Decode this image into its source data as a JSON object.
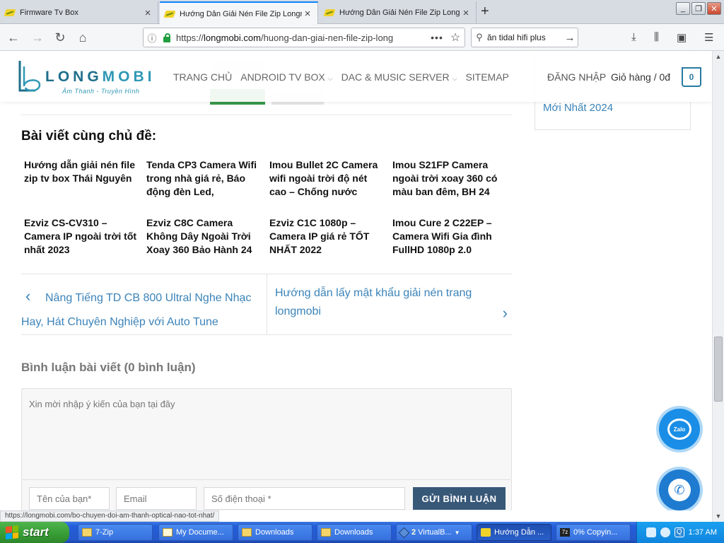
{
  "browser": {
    "tabs": [
      {
        "title": "Firmware Tv Box",
        "active": false
      },
      {
        "title": "Hướng Dẫn Giải Nén File Zip Longmobi",
        "active": true
      },
      {
        "title": "Hướng Dẫn Giải Nén File Zip Longmobi",
        "active": false
      }
    ],
    "url_prefix": "https://",
    "url_domain": "longmobi.com",
    "url_path": "/huong-dan-giai-nen-file-zip-long",
    "search_query": "ăn tidal hifi plus"
  },
  "header": {
    "logo_word_a": "LONG",
    "logo_word_b": "MOBI",
    "logo_tagline": "Âm Thanh - Truyền Hình",
    "nav": [
      {
        "label": "TRANG CHỦ",
        "has_caret": false
      },
      {
        "label": "ANDROID TV BOX",
        "has_caret": true
      },
      {
        "label": "DAC & MUSIC SERVER",
        "has_caret": true
      },
      {
        "label": "SITEMAP",
        "has_caret": false
      }
    ],
    "login": "ĐĂNG NHẬP",
    "cart_label": "Giỏ hàng / 0đ",
    "cart_count": "0"
  },
  "sidebar": {
    "link_tail": "Mới Nhất 2024"
  },
  "related": {
    "title": "Bài viết cùng chủ đề:",
    "items": [
      "Hướng dẫn giải nén file zip tv box Thái Nguyên",
      "Tenda CP3 Camera Wifi trong nhà giá rẻ, Báo động đèn Led,",
      "Imou Bullet 2C Camera wifi ngoài trời độ nét cao – Chống nước",
      "Imou S21FP Camera ngoài trời xoay 360 có màu ban đêm, BH 24",
      "Ezviz CS-CV310 – Camera IP ngoài trời tốt nhất 2023",
      "Ezviz C8C Camera Không Dây Ngoài Trời Xoay 360 Bảo Hành 24",
      "Ezviz C1C 1080p – Camera IP giá rẻ TỐT NHẤT 2022",
      "Imou Cure 2 C22EP – Camera Wifi Gia đình FullHD 1080p 2.0"
    ]
  },
  "post_nav": {
    "prev": "Nâng Tiếng TD CB 800 Ultral Nghe Nhạc Hay, Hát Chuyên Nghiệp với Auto Tune",
    "next": "Hướng dẫn lấy mật khẩu giải nén trang longmobi"
  },
  "comments": {
    "title": "Bình luận bài viết (0 bình luận)",
    "textarea_placeholder": "Xin mời nhập ý kiến của bạn tại đây",
    "name_placeholder": "Tên của bạn*",
    "email_placeholder": "Email",
    "phone_placeholder": "Số điện thoại *",
    "submit": "GỬI BÌNH LUẬN"
  },
  "floating": {
    "zalo_label": "Zalo"
  },
  "status_url": "https://longmobi.com/bo-chuyen-doi-am-thanh-optical-nao-tot-nhat/",
  "taskbar": {
    "start": "start",
    "tasks": [
      {
        "label": "7-Zip",
        "icon": "folder-icon"
      },
      {
        "label": "My Docume...",
        "icon": "document-icon"
      },
      {
        "label": "Downloads",
        "icon": "folder-icon"
      },
      {
        "label": "Downloads",
        "icon": "folder-icon"
      },
      {
        "label": "VirtualB...",
        "icon": "virtualbox-icon",
        "count": "2"
      },
      {
        "label": "Hướng Dẫn ...",
        "icon": "firefox-icon"
      },
      {
        "label": "0% Copyin...",
        "icon": "7zip-icon"
      }
    ],
    "clock": "1:37 AM"
  }
}
